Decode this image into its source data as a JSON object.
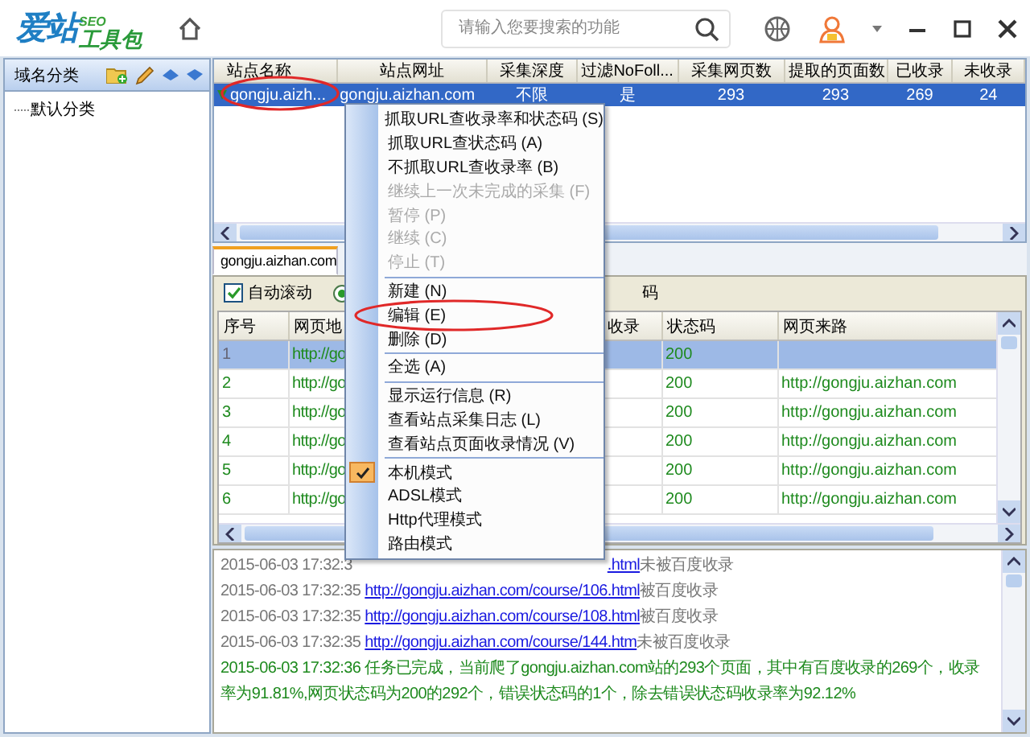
{
  "app": {
    "logo": {
      "name": "爱站",
      "badge": "SEO",
      "suffix": "工具包"
    },
    "search": {
      "placeholder": "请输入您要搜索的功能"
    }
  },
  "sidebar": {
    "title": "域名分类",
    "items": [
      {
        "label": "默认分类"
      }
    ]
  },
  "sites": {
    "columns": [
      "站点名称",
      "站点网址",
      "采集深度",
      "过滤NoFoll...",
      "采集网页数",
      "提取的页面数",
      "已收录",
      "未收录"
    ],
    "rows": [
      {
        "cells": [
          "gongju.aizh...",
          "gongju.aizhan.com",
          "不限",
          "是",
          "293",
          "293",
          "269",
          "24"
        ],
        "selected": true
      }
    ]
  },
  "tabs": [
    {
      "label": "gongju.aizhan.com",
      "selected": true
    }
  ],
  "toolbar": {
    "auto_scroll": {
      "label": "自动滚动",
      "checked": true
    },
    "radio": {
      "selected": true
    },
    "partial_label": "码"
  },
  "pages": {
    "columns": [
      "序号",
      "网页地",
      "收录",
      "状态码",
      "网页来路"
    ],
    "rows": [
      {
        "index": "1",
        "url": "http://go",
        "status": "200",
        "selected": true
      },
      {
        "index": "2",
        "url": "http://go",
        "status": "200",
        "referrer": "http://gongju.aizhan.com",
        "selected": false
      },
      {
        "index": "3",
        "url": "http://go",
        "status": "200",
        "referrer": "http://gongju.aizhan.com",
        "selected": false
      },
      {
        "index": "4",
        "url": "http://go",
        "status": "200",
        "referrer": "http://gongju.aizhan.com",
        "selected": false
      },
      {
        "index": "5",
        "url": "http://go",
        "status": "200",
        "referrer": "http://gongju.aizhan.com",
        "selected": false
      },
      {
        "index": "6",
        "url": "http://go",
        "status": "200",
        "referrer": "http://gongju.aizhan.com",
        "selected": false
      }
    ]
  },
  "menu": {
    "items": [
      {
        "kind": "item",
        "label": "抓取URL查收录率和状态码 (S)",
        "disabled": false,
        "checked": false
      },
      {
        "kind": "item",
        "label": "抓取URL查状态码 (A)",
        "disabled": false,
        "checked": false
      },
      {
        "kind": "item",
        "label": "不抓取URL查收录率 (B)",
        "disabled": false,
        "checked": false
      },
      {
        "kind": "item",
        "label": "继续上一次未完成的采集 (F)",
        "disabled": true,
        "checked": false
      },
      {
        "kind": "item",
        "label": "暂停 (P)",
        "disabled": true,
        "checked": false
      },
      {
        "kind": "item",
        "label": "继续 (C)",
        "disabled": true,
        "checked": false
      },
      {
        "kind": "item",
        "label": "停止 (T)",
        "disabled": true,
        "checked": false
      },
      {
        "kind": "separator"
      },
      {
        "kind": "item",
        "label": "新建 (N)",
        "disabled": false,
        "checked": false
      },
      {
        "kind": "item",
        "label": "编辑 (E)",
        "disabled": false,
        "checked": false
      },
      {
        "kind": "item",
        "label": "删除 (D)",
        "disabled": false,
        "checked": false
      },
      {
        "kind": "separator"
      },
      {
        "kind": "item",
        "label": "全选 (A)",
        "disabled": false,
        "checked": false
      },
      {
        "kind": "separator"
      },
      {
        "kind": "item",
        "label": "显示运行信息 (R)",
        "disabled": false,
        "checked": false
      },
      {
        "kind": "item",
        "label": "查看站点采集日志 (L)",
        "disabled": false,
        "checked": false
      },
      {
        "kind": "item",
        "label": "查看站点页面收录情况 (V)",
        "disabled": false,
        "checked": false
      },
      {
        "kind": "separator"
      },
      {
        "kind": "item",
        "label": "本机模式",
        "disabled": false,
        "checked": true
      },
      {
        "kind": "item",
        "label": "ADSL模式",
        "disabled": false,
        "checked": false
      },
      {
        "kind": "item",
        "label": "Http代理模式",
        "disabled": false,
        "checked": false
      },
      {
        "kind": "item",
        "label": "路由模式",
        "disabled": false,
        "checked": false
      }
    ]
  },
  "log": {
    "lines": [
      {
        "kind": "partial",
        "time": "2015-06-03 17:32:3",
        "link": ".html",
        "note": "未被百度收录"
      },
      {
        "kind": "link",
        "time": "2015-06-03 17:32:35",
        "link": "http://gongju.aizhan.com/course/106.html",
        "note": "被百度收录"
      },
      {
        "kind": "link",
        "time": "2015-06-03 17:32:35",
        "link": "http://gongju.aizhan.com/course/108.html",
        "note": "被百度收录"
      },
      {
        "kind": "link",
        "time": "2015-06-03 17:32:35",
        "link": "http://gongju.aizhan.com/course/144.htm",
        "note": "未被百度收录"
      },
      {
        "kind": "message",
        "text": "2015-06-03 17:32:36 任务已完成，当前爬了gongju.aizhan.com站的293个页面，其中有百度收录的269个，收录率为91.81%,网页状态码为200的292个，错误状态码的1个，除去错误状态码收录率为92.12%"
      }
    ]
  }
}
